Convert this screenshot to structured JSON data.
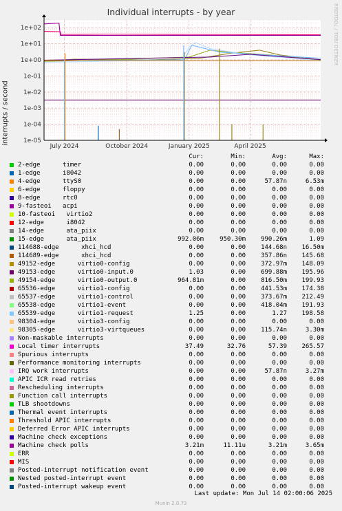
{
  "chart_data": {
    "type": "line",
    "title": "Individual interrupts - by year",
    "ylabel": "interrupts / second",
    "yscale": "log",
    "ylim": [
      1e-05,
      300
    ],
    "yticks": [
      "1e+02",
      "1e+01",
      "1e+00",
      "1e-01",
      "1e-02",
      "1e-03",
      "1e-04",
      "1e-05"
    ],
    "xlim": [
      "2024-06-01",
      "2025-07-14"
    ],
    "xticks": [
      {
        "date": "2024-07-01",
        "label": "July 2024"
      },
      {
        "date": "2024-10-01",
        "label": "October 2024"
      },
      {
        "date": "2025-01-01",
        "label": "January 2025"
      },
      {
        "date": "2025-04-01",
        "label": "April 2025"
      }
    ],
    "grid": true,
    "series": [
      {
        "name": "9-fasteoi acpi",
        "color": "#990099",
        "points": [
          [
            "2024-06-01",
            170
          ],
          [
            "2024-06-23",
            190
          ],
          [
            "2024-06-25",
            33
          ],
          [
            "2025-07-14",
            33
          ]
        ]
      },
      {
        "name": "Local timer interrupts",
        "color": "#ee1177",
        "points": [
          [
            "2024-06-01",
            60
          ],
          [
            "2024-06-25",
            55
          ],
          [
            "2024-06-26",
            38
          ],
          [
            "2024-09-01",
            40
          ],
          [
            "2025-01-01",
            38
          ],
          [
            "2025-07-14",
            36
          ]
        ]
      },
      {
        "name": "Machine check polls",
        "color": "#660066",
        "points": [
          [
            "2024-06-01",
            0.0032
          ],
          [
            "2025-07-14",
            0.0032
          ]
        ]
      },
      {
        "name": "15-edge ata_piix",
        "color": "#998822",
        "points": [
          [
            "2024-06-01",
            0.9
          ],
          [
            "2024-06-25",
            0.95
          ],
          [
            "2024-07-15",
            1.1
          ],
          [
            "2024-11-01",
            1.0
          ],
          [
            "2025-01-15",
            1.2
          ],
          [
            "2025-03-01",
            2.5
          ],
          [
            "2025-04-15",
            4.0
          ],
          [
            "2025-05-15",
            2.0
          ],
          [
            "2025-07-14",
            0.99
          ]
        ]
      },
      {
        "name": "49154-edge virtio0-output.0",
        "color": "#99aa22",
        "points": [
          [
            "2024-06-01",
            0.8
          ],
          [
            "2024-09-01",
            1.0
          ],
          [
            "2025-01-01",
            1.5
          ],
          [
            "2025-02-01",
            4.0
          ],
          [
            "2025-03-01",
            3.0
          ],
          [
            "2025-05-01",
            2.0
          ],
          [
            "2025-07-14",
            0.96
          ]
        ]
      },
      {
        "name": "65537-edge virtio1-control",
        "color": "#bbddff",
        "points": [
          [
            "2024-06-01",
            0.7
          ],
          [
            "2024-12-20",
            1.0
          ],
          [
            "2025-01-01",
            6.0
          ],
          [
            "2025-01-10",
            12.0
          ],
          [
            "2025-02-01",
            5.0
          ],
          [
            "2025-04-01",
            2.0
          ],
          [
            "2025-07-14",
            0.9
          ]
        ]
      },
      {
        "name": "65539-edge virtio1-request",
        "color": "#77bbff",
        "points": [
          [
            "2024-06-01",
            0.9
          ],
          [
            "2024-12-25",
            1.0
          ],
          [
            "2025-01-05",
            8.0
          ],
          [
            "2025-02-15",
            3.0
          ],
          [
            "2025-07-14",
            1.25
          ]
        ]
      },
      {
        "name": "49153-edge virtio0-input.0",
        "color": "#661188",
        "points": [
          [
            "2024-06-01",
            0.95
          ],
          [
            "2025-02-01",
            1.5
          ],
          [
            "2025-04-01",
            2.2
          ],
          [
            "2025-07-14",
            1.03
          ]
        ]
      },
      {
        "name": "114689-edge xhci_hcd",
        "color": "#bb7711",
        "points": [
          [
            "2024-06-01",
            0.9
          ],
          [
            "2025-07-14",
            0.9
          ]
        ]
      }
    ],
    "spikes": [
      {
        "name": "1-edge i8042",
        "color": "#0066b3",
        "date": "2024-08-20",
        "low": 1e-05,
        "high": 8e-05
      },
      {
        "name": "4-edge ttyS0",
        "color": "#ff8000",
        "date": "2024-07-02",
        "low": 1e-05,
        "high": 2.5
      },
      {
        "name": "15-edge ata_piix",
        "color": "#998822",
        "date": "2024-12-25",
        "low": 1e-05,
        "high": 3.0
      },
      {
        "name": "15-edge ata_piix",
        "color": "#998822",
        "date": "2025-02-15",
        "low": 1e-05,
        "high": 5.0
      },
      {
        "name": "15-edge ata_piix",
        "color": "#998822",
        "date": "2025-03-05",
        "low": 1e-05,
        "high": 0.0001
      },
      {
        "name": "15-edge ata_piix",
        "color": "#998822",
        "date": "2025-04-20",
        "low": 1e-05,
        "high": 0.0001
      },
      {
        "name": "49152-edge virtio0-config",
        "color": "#996633",
        "date": "2024-09-20",
        "low": 1e-05,
        "high": 5e-05
      },
      {
        "name": "65539-edge virtio1-request",
        "color": "#77bbff",
        "date": "2024-12-24",
        "low": 1e-05,
        "high": 8.0
      },
      {
        "name": "65539-edge virtio1-request",
        "color": "#77bbff",
        "date": "2024-07-01",
        "low": 1e-05,
        "high": 1.0
      }
    ]
  },
  "watermark": "RRDTOOL / TOBI OETIKER",
  "legend": {
    "headers": {
      "cur": "Cur:",
      "min": "Min:",
      "avg": "Avg:",
      "max": "Max:"
    },
    "rows": [
      {
        "name": "2-edge      timer",
        "color": "#00cc00",
        "cur": "0.00",
        "min": "0.00",
        "avg": "0.00",
        "max": "0.00"
      },
      {
        "name": "1-edge      i8042",
        "color": "#0066b3",
        "cur": "0.00",
        "min": "0.00",
        "avg": "0.00",
        "max": "0.00"
      },
      {
        "name": "4-edge      ttyS0",
        "color": "#ff8000",
        "cur": "0.00",
        "min": "0.00",
        "avg": "57.87n",
        "max": "6.53m"
      },
      {
        "name": "6-edge      floppy",
        "color": "#ffcc00",
        "cur": "0.00",
        "min": "0.00",
        "avg": "0.00",
        "max": "0.00"
      },
      {
        "name": "8-edge      rtc0",
        "color": "#330099",
        "cur": "0.00",
        "min": "0.00",
        "avg": "0.00",
        "max": "0.00"
      },
      {
        "name": "9-fasteoi   acpi",
        "color": "#990099",
        "cur": "0.00",
        "min": "0.00",
        "avg": "0.00",
        "max": "0.00"
      },
      {
        "name": "10-fasteoi   virtio2",
        "color": "#ccff00",
        "cur": "0.00",
        "min": "0.00",
        "avg": "0.00",
        "max": "0.00"
      },
      {
        "name": "12-edge      i8042",
        "color": "#ff0000",
        "cur": "0.00",
        "min": "0.00",
        "avg": "0.00",
        "max": "0.00"
      },
      {
        "name": "14-edge      ata_piix",
        "color": "#808080",
        "cur": "0.00",
        "min": "0.00",
        "avg": "0.00",
        "max": "0.00"
      },
      {
        "name": "15-edge      ata_piix",
        "color": "#008f00",
        "cur": "992.06m",
        "min": "950.30m",
        "avg": "990.26m",
        "max": "1.09"
      },
      {
        "name": "114688-edge      xhci_hcd",
        "color": "#00487d",
        "cur": "0.00",
        "min": "0.00",
        "avg": "144.68n",
        "max": "16.50m"
      },
      {
        "name": "114689-edge      xhci_hcd",
        "color": "#b35a00",
        "cur": "0.00",
        "min": "0.00",
        "avg": "357.86n",
        "max": "145.68"
      },
      {
        "name": "49152-edge      virtio0-config",
        "color": "#b38f00",
        "cur": "0.00",
        "min": "0.00",
        "avg": "372.97m",
        "max": "148.09"
      },
      {
        "name": "49153-edge      virtio0-input.0",
        "color": "#6b006b",
        "cur": "1.03",
        "min": "0.00",
        "avg": "699.88m",
        "max": "195.96"
      },
      {
        "name": "49154-edge      virtio0-output.0",
        "color": "#8fb300",
        "cur": "964.81m",
        "min": "0.00",
        "avg": "816.50m",
        "max": "199.93"
      },
      {
        "name": "65536-edge      virtio1-config",
        "color": "#b30000",
        "cur": "0.00",
        "min": "0.00",
        "avg": "441.53m",
        "max": "174.38"
      },
      {
        "name": "65537-edge      virtio1-control",
        "color": "#bebebe",
        "cur": "0.00",
        "min": "0.00",
        "avg": "373.67m",
        "max": "212.49"
      },
      {
        "name": "65538-edge      virtio1-event",
        "color": "#80ff80",
        "cur": "0.00",
        "min": "0.00",
        "avg": "418.04m",
        "max": "191.93"
      },
      {
        "name": "65539-edge      virtio1-request",
        "color": "#80c9ff",
        "cur": "1.25",
        "min": "0.00",
        "avg": "1.27",
        "max": "198.58"
      },
      {
        "name": "98304-edge      virtio3-config",
        "color": "#ffc080",
        "cur": "0.00",
        "min": "0.00",
        "avg": "0.00",
        "max": "0.00"
      },
      {
        "name": "98305-edge      virtio3-virtqueues",
        "color": "#ffe680",
        "cur": "0.00",
        "min": "0.00",
        "avg": "115.74n",
        "max": "3.30m"
      },
      {
        "name": "Non-maskable interrupts",
        "color": "#aa80ff",
        "cur": "0.00",
        "min": "0.00",
        "avg": "0.00",
        "max": "0.00"
      },
      {
        "name": "Local timer interrupts",
        "color": "#ee00cc",
        "cur": "37.49",
        "min": "32.76",
        "avg": "57.39",
        "max": "265.57"
      },
      {
        "name": "Spurious interrupts",
        "color": "#ff8080",
        "cur": "0.00",
        "min": "0.00",
        "avg": "0.00",
        "max": "0.00"
      },
      {
        "name": "Performance monitoring interrupts",
        "color": "#666600",
        "cur": "0.00",
        "min": "0.00",
        "avg": "0.00",
        "max": "0.00"
      },
      {
        "name": "IRQ work interrupts",
        "color": "#ffbfff",
        "cur": "0.00",
        "min": "0.00",
        "avg": "57.87n",
        "max": "3.27m"
      },
      {
        "name": "APIC ICR read retries",
        "color": "#00ffcc",
        "cur": "0.00",
        "min": "0.00",
        "avg": "0.00",
        "max": "0.00"
      },
      {
        "name": "Rescheduling interrupts",
        "color": "#cc6699",
        "cur": "0.00",
        "min": "0.00",
        "avg": "0.00",
        "max": "0.00"
      },
      {
        "name": "Function call interrupts",
        "color": "#999900",
        "cur": "0.00",
        "min": "0.00",
        "avg": "0.00",
        "max": "0.00"
      },
      {
        "name": "TLB shootdowns",
        "color": "#00cc00",
        "cur": "0.00",
        "min": "0.00",
        "avg": "0.00",
        "max": "0.00"
      },
      {
        "name": "Thermal event interrupts",
        "color": "#0066b3",
        "cur": "0.00",
        "min": "0.00",
        "avg": "0.00",
        "max": "0.00"
      },
      {
        "name": "Threshold APIC interrupts",
        "color": "#ff8000",
        "cur": "0.00",
        "min": "0.00",
        "avg": "0.00",
        "max": "0.00"
      },
      {
        "name": "Deferred Error APIC interrupts",
        "color": "#ffcc00",
        "cur": "0.00",
        "min": "0.00",
        "avg": "0.00",
        "max": "0.00"
      },
      {
        "name": "Machine check exceptions",
        "color": "#330099",
        "cur": "0.00",
        "min": "0.00",
        "avg": "0.00",
        "max": "0.00"
      },
      {
        "name": "Machine check polls",
        "color": "#990099",
        "cur": "3.21m",
        "min": "11.11u",
        "avg": "3.21m",
        "max": "3.65m"
      },
      {
        "name": "ERR",
        "color": "#ccff00",
        "cur": "0.00",
        "min": "0.00",
        "avg": "0.00",
        "max": "0.00"
      },
      {
        "name": "MIS",
        "color": "#ff0000",
        "cur": "0.00",
        "min": "0.00",
        "avg": "0.00",
        "max": "0.00"
      },
      {
        "name": "Posted-interrupt notification event",
        "color": "#808080",
        "cur": "0.00",
        "min": "0.00",
        "avg": "0.00",
        "max": "0.00"
      },
      {
        "name": "Nested posted-interrupt event",
        "color": "#008f00",
        "cur": "0.00",
        "min": "0.00",
        "avg": "0.00",
        "max": "0.00"
      },
      {
        "name": "Posted-interrupt wakeup event",
        "color": "#00487d",
        "cur": "0.00",
        "min": "0.00",
        "avg": "0.00",
        "max": "0.00"
      }
    ]
  },
  "last_update": "Last update: Mon Jul 14 02:00:06 2025",
  "version": "Munin 2.0.73"
}
